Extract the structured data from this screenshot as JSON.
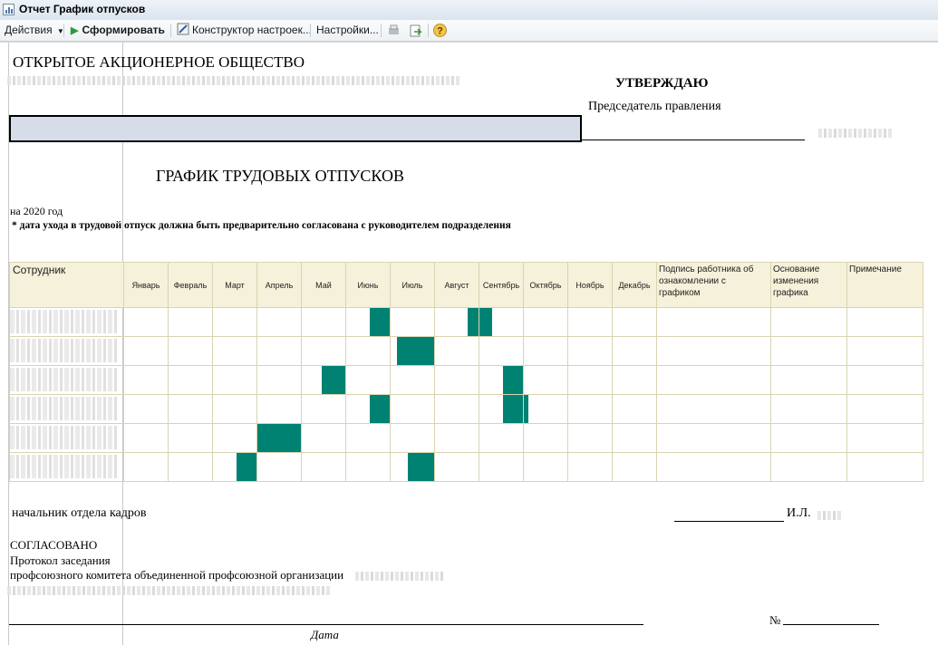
{
  "window": {
    "title": "Отчет  График отпусков"
  },
  "toolbar": {
    "actions": "Действия",
    "generate": "Сформировать",
    "constructor": "Конструктор настроек...",
    "settings": "Настройки..."
  },
  "report": {
    "org_heading": "ОТКРЫТОЕ АКЦИОНЕРНОЕ ОБЩЕСТВО",
    "approve": "УТВЕРЖДАЮ",
    "chairman": "Председатель правления",
    "title": "ГРАФИК ТРУДОВЫХ ОТПУСКОВ",
    "year": "на 2020 год",
    "note": "* дата ухода в трудовой отпуск должна быть предварительно согласована с руководителем подразделения",
    "table": {
      "col_employee": "Сотрудник",
      "months": [
        "Январь",
        "Февраль",
        "Март",
        "Апрель",
        "Май",
        "Июнь",
        "Июль",
        "Август",
        "Сентябрь",
        "Октябрь",
        "Ноябрь",
        "Декабрь"
      ],
      "col_signature": "Подпись работника об ознакомлении с графиком",
      "col_reason": "Основание изменения графика",
      "col_note": "Примечание",
      "rows": [
        {
          "vacations": [
            {
              "month": 6,
              "from": 0.55,
              "to": 1.0
            },
            {
              "month": 8,
              "from": 0.75,
              "to": 1.0
            },
            {
              "month": 9,
              "from": 0.0,
              "to": 0.3
            }
          ]
        },
        {
          "vacations": [
            {
              "month": 7,
              "from": 0.15,
              "to": 1.0
            },
            {
              "month": 8,
              "from": 0.0,
              "to": 0.0
            }
          ]
        },
        {
          "vacations": [
            {
              "month": 5,
              "from": 0.45,
              "to": 1.0
            },
            {
              "month": 9,
              "from": 0.55,
              "to": 1.0
            }
          ]
        },
        {
          "vacations": [
            {
              "month": 6,
              "from": 0.55,
              "to": 1.0
            },
            {
              "month": 9,
              "from": 0.55,
              "to": 1.0
            },
            {
              "month": 10,
              "from": 0.0,
              "to": 0.1
            }
          ]
        },
        {
          "vacations": [
            {
              "month": 4,
              "from": 0.0,
              "to": 1.0
            },
            {
              "month": 5,
              "from": 0.0,
              "to": 0.0
            }
          ]
        },
        {
          "vacations": [
            {
              "month": 3,
              "from": 0.55,
              "to": 1.0
            },
            {
              "month": 7,
              "from": 0.4,
              "to": 1.0
            }
          ]
        }
      ]
    },
    "hr_head": "начальник отдела кадров",
    "initials": "И.Л.",
    "agreed": "СОГЛАСОВАНО",
    "protocol": "Протокол заседания",
    "committee": "профсоюзного комитета объединенной профсоюзной организации",
    "date_label": "Дата",
    "number_label": "№"
  },
  "colors": {
    "bar": "#008273",
    "header_bg": "#f5f1da",
    "field_bg": "#d6dde8"
  }
}
